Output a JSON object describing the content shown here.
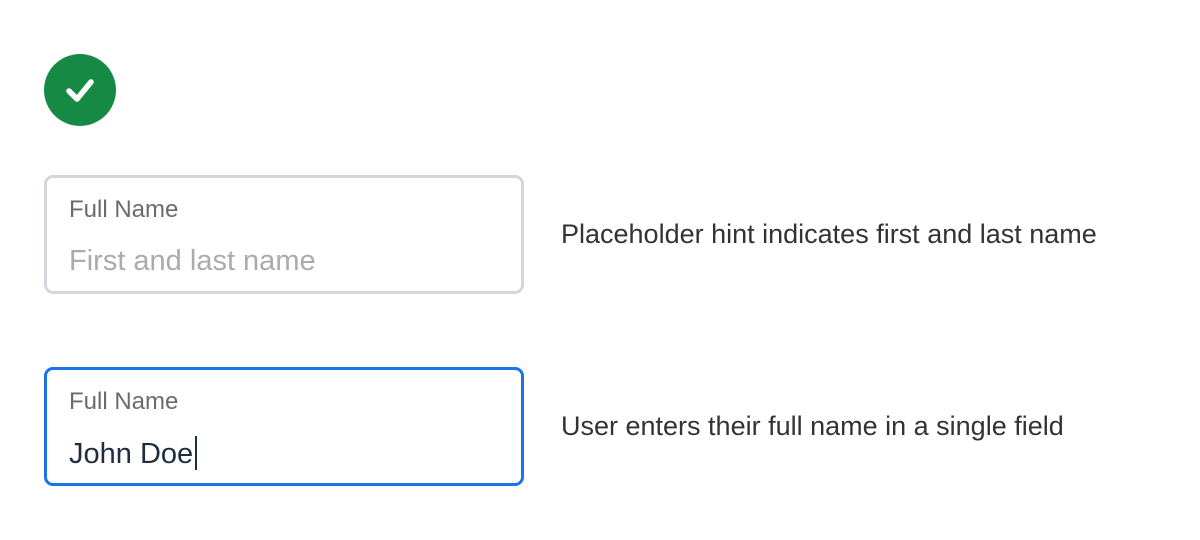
{
  "status": {
    "icon": "check-circle-icon",
    "color": "#168a45"
  },
  "examples": [
    {
      "field_label": "Full Name",
      "placeholder": "First and last name",
      "value": "",
      "state": "empty",
      "border_color": "#d3d6db",
      "description": "Placeholder hint indicates first and last name"
    },
    {
      "field_label": "Full Name",
      "placeholder": "",
      "value": "John Doe",
      "state": "focused",
      "border_color": "#1a73e8",
      "description": "User enters their full name in a single field"
    }
  ]
}
